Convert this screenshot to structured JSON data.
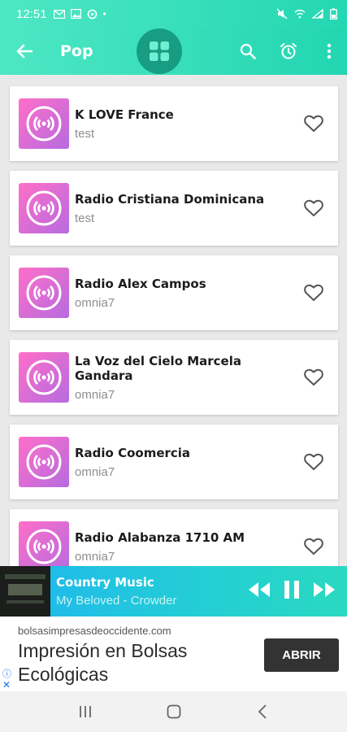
{
  "status": {
    "time": "12:51"
  },
  "header": {
    "title": "Pop"
  },
  "stations": [
    {
      "name": "K LOVE France",
      "subtitle": "test"
    },
    {
      "name": "Radio Cristiana Dominicana",
      "subtitle": "test"
    },
    {
      "name": "Radio Alex Campos",
      "subtitle": "omnia7"
    },
    {
      "name": "La Voz del Cielo Marcela Gandara",
      "subtitle": "omnia7"
    },
    {
      "name": "Radio Coomercia",
      "subtitle": "omnia7"
    },
    {
      "name": "Radio Alabanza 1710 AM",
      "subtitle": "omnia7"
    }
  ],
  "player": {
    "title": "Country Music",
    "subtitle": "My Beloved - Crowder"
  },
  "ad": {
    "url": "bolsasimpresasdeoccidente.com",
    "headline": "Impresión en Bolsas Ecológicas",
    "button": "ABRIR"
  },
  "colors": {
    "accent": "#27d8b3",
    "grid_button": "#179d83",
    "thumb_start": "#ff6fc8",
    "thumb_end": "#b66be0"
  },
  "icons": {
    "back": "arrow-left-icon",
    "grid": "grid-icon",
    "search": "search-icon",
    "alarm": "alarm-icon",
    "more": "more-vert-icon",
    "station": "radio-waves-icon",
    "favorite": "heart-outline-icon",
    "rewind": "rewind-icon",
    "pause": "pause-icon",
    "forward": "fast-forward-icon"
  }
}
